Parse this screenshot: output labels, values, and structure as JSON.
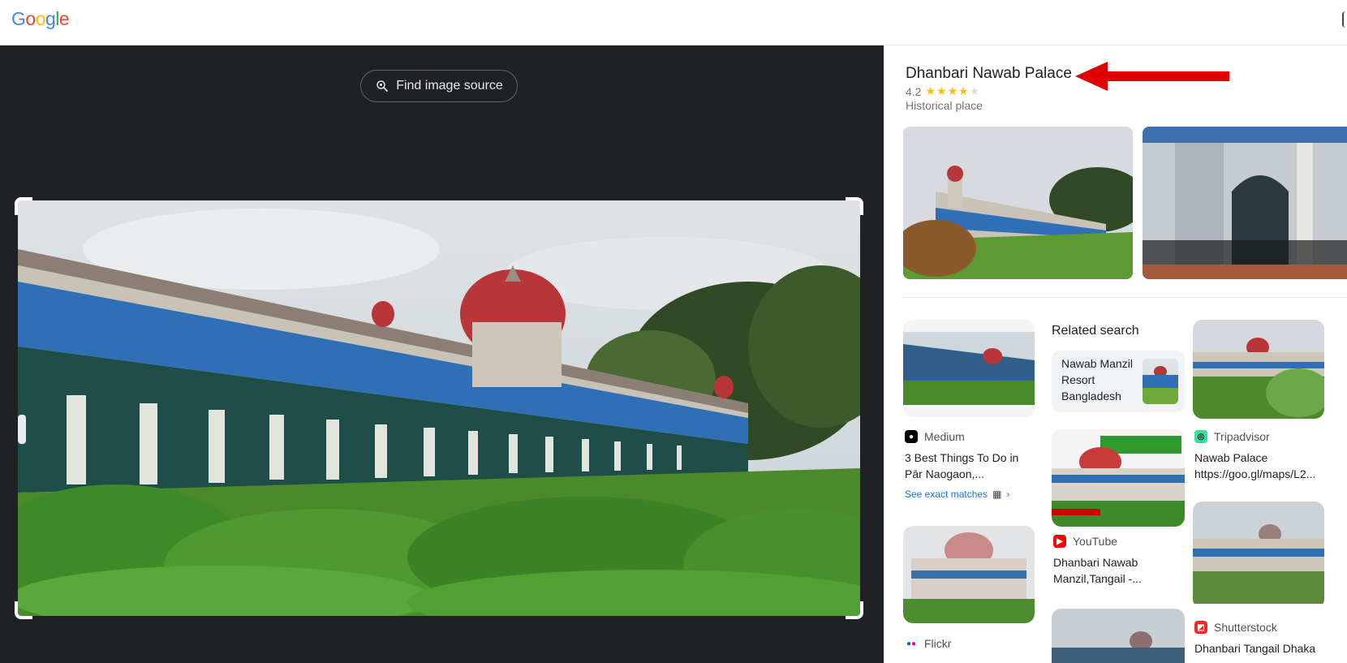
{
  "header": {
    "logo_letters": [
      {
        "ch": "G",
        "color": "#4285F4"
      },
      {
        "ch": "o",
        "color": "#EA4335"
      },
      {
        "ch": "o",
        "color": "#FBBC05"
      },
      {
        "ch": "g",
        "color": "#4285F4"
      },
      {
        "ch": "l",
        "color": "#34A853"
      },
      {
        "ch": "e",
        "color": "#EA4335"
      }
    ]
  },
  "viewer": {
    "find_source_label": "Find image source"
  },
  "knowledge_panel": {
    "title": "Dhanbari Nawab Palace",
    "rating": "4.2",
    "stars_filled": 4,
    "stars_total": 5,
    "type": "Historical place"
  },
  "results": {
    "col1": [
      {
        "source": "Medium",
        "title": "3 Best Things To Do in Pār Naogaon,...",
        "exact_label": "See exact matches"
      },
      {
        "source": "Flickr"
      }
    ],
    "related": {
      "heading": "Related search",
      "query": "Nawab Manzil Resort Bangladesh"
    },
    "col2": [
      {
        "source": "YouTube",
        "title": "Dhanbari Nawab Manzil,Tangail -..."
      }
    ],
    "col3": [
      {
        "source": "Tripadvisor",
        "title": "Nawab Palace https://goo.gl/maps/L2..."
      },
      {
        "source": "Shutterstock",
        "title": "Dhanbari Tangail Dhaka"
      }
    ]
  },
  "colors": {
    "accent_link": "#1a73e8",
    "dark_bg": "#202124",
    "star": "#fbbc04",
    "arrow": "#e00000"
  }
}
